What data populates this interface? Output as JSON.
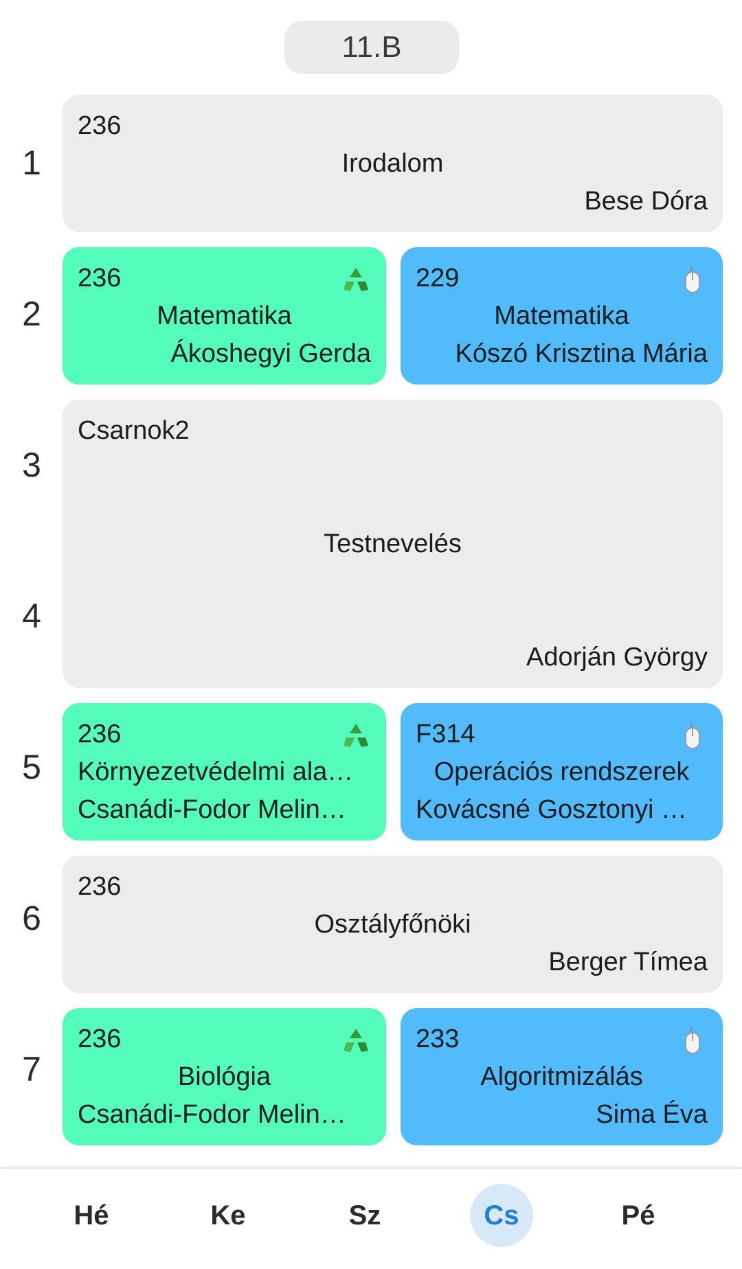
{
  "class_name": "11.B",
  "periods": [
    "1",
    "2",
    "3",
    "4",
    "5",
    "6",
    "7"
  ],
  "lessons": {
    "p1": {
      "room": "236",
      "subject": "Irodalom",
      "teacher": "Bese Dóra"
    },
    "p2a": {
      "room": "236",
      "subject": "Matematika",
      "teacher": "Ákoshegyi Gerda",
      "icon": "recycle-icon"
    },
    "p2b": {
      "room": "229",
      "subject": "Matematika",
      "teacher": "Kószó Krisztina Mária",
      "icon": "mouse-icon"
    },
    "p34": {
      "room": "Csarnok2",
      "subject": "Testnevelés",
      "teacher": "Adorján György"
    },
    "p5a": {
      "room": "236",
      "subject": "Környezetvédelmi ala…",
      "teacher": "Csanádi-Fodor Melin…",
      "icon": "recycle-icon"
    },
    "p5b": {
      "room": "F314",
      "subject": "Operációs rendszerek",
      "teacher": "Kovácsné Gosztonyi …",
      "icon": "mouse-icon"
    },
    "p6": {
      "room": "236",
      "subject": "Osztályfőnöki",
      "teacher": "Berger Tímea"
    },
    "p7a": {
      "room": "236",
      "subject": "Biológia",
      "teacher": "Csanádi-Fodor Melin…",
      "icon": "recycle-icon"
    },
    "p7b": {
      "room": "233",
      "subject": "Algoritmizálás",
      "teacher": "Sima Éva",
      "icon": "mouse-icon"
    }
  },
  "colors": {
    "grey_card": "#ececec",
    "green_group": "#54fcbc",
    "blue_group": "#52bbfc",
    "peek_red": "#f08880",
    "peek_green": "#6cf08a",
    "peek_purple": "#8c7cf0",
    "active_day": "#1e7fd8"
  },
  "days": [
    {
      "label": "Hé",
      "active": false
    },
    {
      "label": "Ke",
      "active": false
    },
    {
      "label": "Sz",
      "active": false
    },
    {
      "label": "Cs",
      "active": true
    },
    {
      "label": "Pé",
      "active": false
    }
  ]
}
